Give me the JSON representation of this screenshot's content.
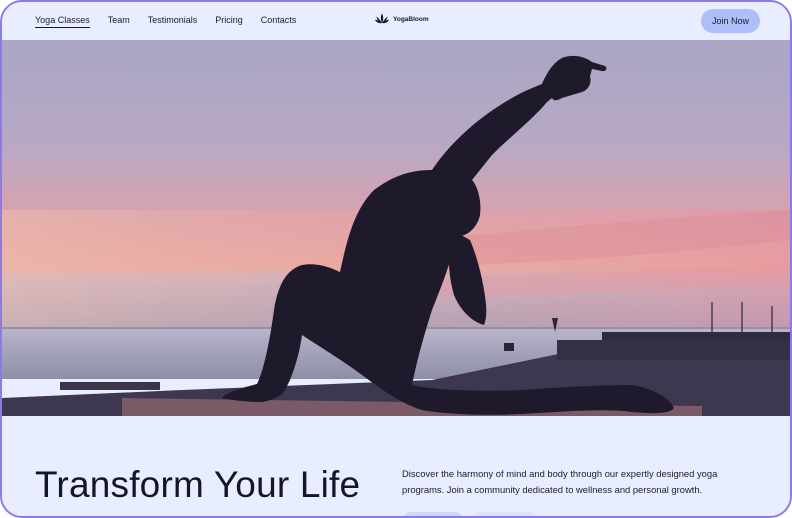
{
  "nav": {
    "links": [
      "Yoga Classes",
      "Team",
      "Testimonials",
      "Pricing",
      "Contacts"
    ],
    "active_index": 0
  },
  "logo": {
    "text": "YogaBloom",
    "icon": "lotus-icon"
  },
  "join_button": {
    "label": "Join Now"
  },
  "hero": {
    "image": "woman-yoga-lunge-silhouette-sunset-seaside"
  },
  "intro": {
    "headline": "Transform Your Life",
    "description": "Discover the harmony of mind and body through our expertly designed yoga programs. Join a community dedicated to wellness and personal growth."
  },
  "colors": {
    "accent": "#aebef8",
    "background": "#e9eefe",
    "frame": "#8b7ae8",
    "text": "#1a1a2e"
  }
}
